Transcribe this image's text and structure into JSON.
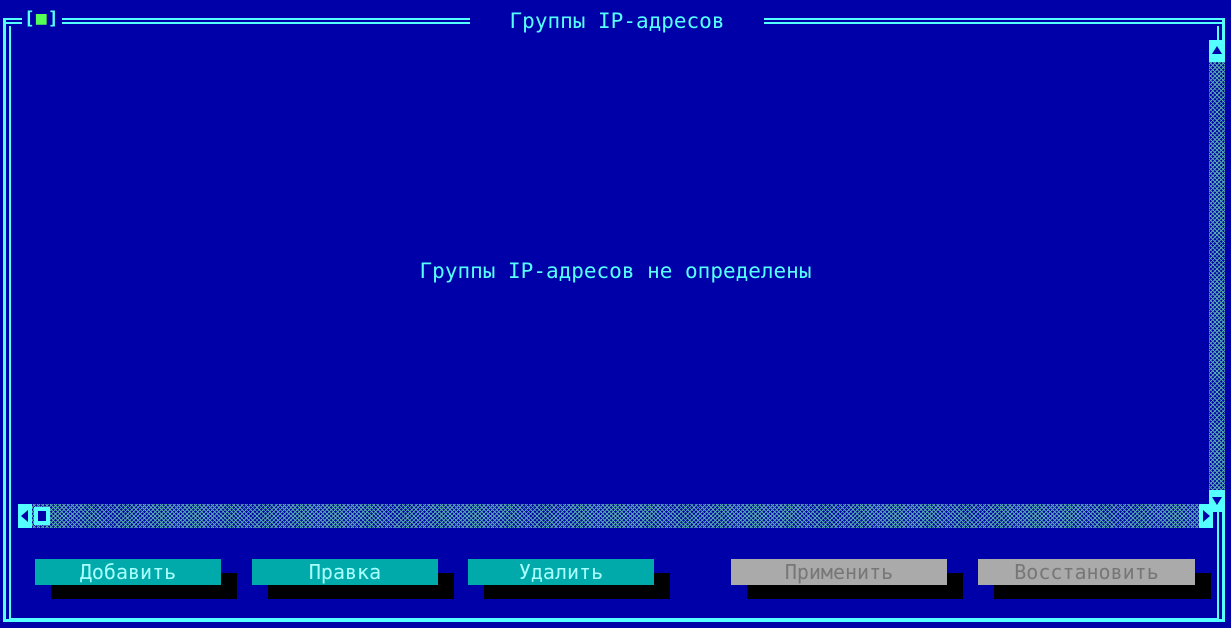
{
  "window": {
    "title": "Группы IP-адресов",
    "close_box": "[",
    "close_box_mark": "■",
    "close_box_end": "]"
  },
  "main": {
    "empty_message": "Группы IP-адресов не определены"
  },
  "buttons": {
    "add": "Добавить",
    "edit": "Правка",
    "delete": "Удалить",
    "apply": "Применить",
    "restore": "Восстановить"
  },
  "states": {
    "add": "enabled",
    "edit": "enabled",
    "delete": "enabled",
    "apply": "disabled",
    "restore": "disabled"
  },
  "colors": {
    "background": "#0000a8",
    "frame": "#55ffff",
    "text": "#55ffff",
    "button_enabled": "#00aaaa",
    "button_disabled": "#aaaaaa",
    "button_shadow": "#000000"
  },
  "icons": {
    "close": "close-box-icon",
    "scroll_up": "arrow-up-icon",
    "scroll_down": "arrow-down-icon",
    "scroll_left": "arrow-left-icon",
    "scroll_right": "arrow-right-icon"
  }
}
